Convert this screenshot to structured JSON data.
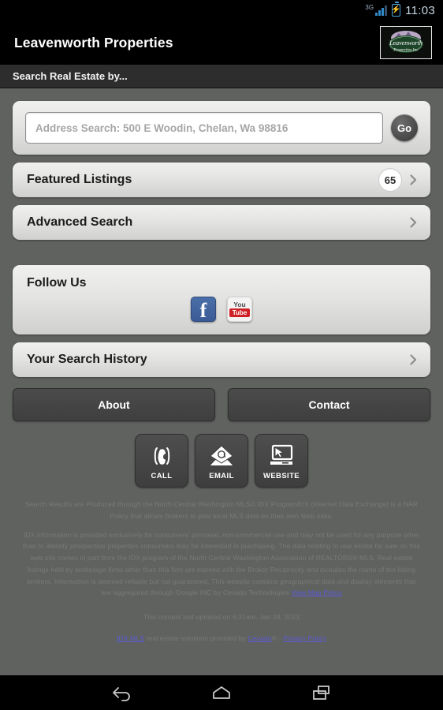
{
  "statusbar": {
    "network_label": "3G",
    "time": "11:03",
    "battery_icon": "battery-charging-icon",
    "signal_icon": "signal-bars-icon"
  },
  "header": {
    "title": "Leavenworth Properties",
    "logo_alt": "Leavenworth Properties Inc logo",
    "subheader": "Search Real Estate by..."
  },
  "search": {
    "placeholder": "Address Search: 500 E Woodin, Chelan, Wa 98816",
    "value": "",
    "go_label": "Go"
  },
  "rows": [
    {
      "label": "Featured Listings",
      "badge": "65",
      "chevron": "chevron-right-icon"
    },
    {
      "label": "Advanced Search",
      "badge": "",
      "chevron": "chevron-right-icon"
    }
  ],
  "follow": {
    "label": "Follow Us",
    "socials": [
      {
        "name": "facebook-icon",
        "glyph": "f"
      },
      {
        "name": "youtube-icon",
        "line1": "You",
        "line2": "Tube"
      }
    ]
  },
  "history": {
    "label": "Your Search History",
    "chevron": "chevron-right-icon"
  },
  "buttons": {
    "about": "About",
    "contact": "Contact"
  },
  "actions": [
    {
      "caption": "CALL",
      "icon": "phone-icon"
    },
    {
      "caption": "EMAIL",
      "icon": "envelope-at-icon"
    },
    {
      "caption": "WEBSITE",
      "icon": "monitor-cursor-icon"
    }
  ],
  "footer": {
    "para1": "Search Results are Produced through the North Central Washington MLS© IDX ProgramIDX (Internet Data Exchange) is a NAR Policy that allows brokers to post local MLS data on their own Web sites.",
    "para2_a": "IDX information is provided exclusively for consumers' personal, non-commercial use and may not be used for any purpose other than to identify prospective properties consumers may be interested in purchasing. The data relating to real estate for sale on this web site comes in part from the IDX program of the North Central Washington Association of REALTORS® MLS. Real estate listings held by brokerage firms other than this firm are marked with the Broker Reciprocity and includes the name of the listing brokers. Information is deemed reliable but not guaranteed. This website contains geographical data and display elements that are aggregated through Google INC by Cevado Technologies ",
    "map_policy_link": "View Map Policy",
    "last_updated": "This content last updated on 6:31am, Jan 29, 2013",
    "provider_link1": "IDX MLS",
    "provider_text1": " real estate solutions provided by ",
    "provider_link2": "Cevado",
    "provider_text2": "® - ",
    "provider_link3": "Privacy Policy"
  },
  "navbar": {
    "back": "back-icon",
    "home": "home-icon",
    "recents": "recent-apps-icon"
  },
  "colors": {
    "page_bg": "#606260",
    "titlebar_bg": "#000000",
    "subheader_bg": "#2d2d2d",
    "card_top": "#f0f0ef",
    "card_bottom": "#d0d0cf",
    "dark_button": "#454545",
    "link": "#5b5bd6",
    "facebook": "#3b5a96",
    "youtube": "#cf2026"
  }
}
